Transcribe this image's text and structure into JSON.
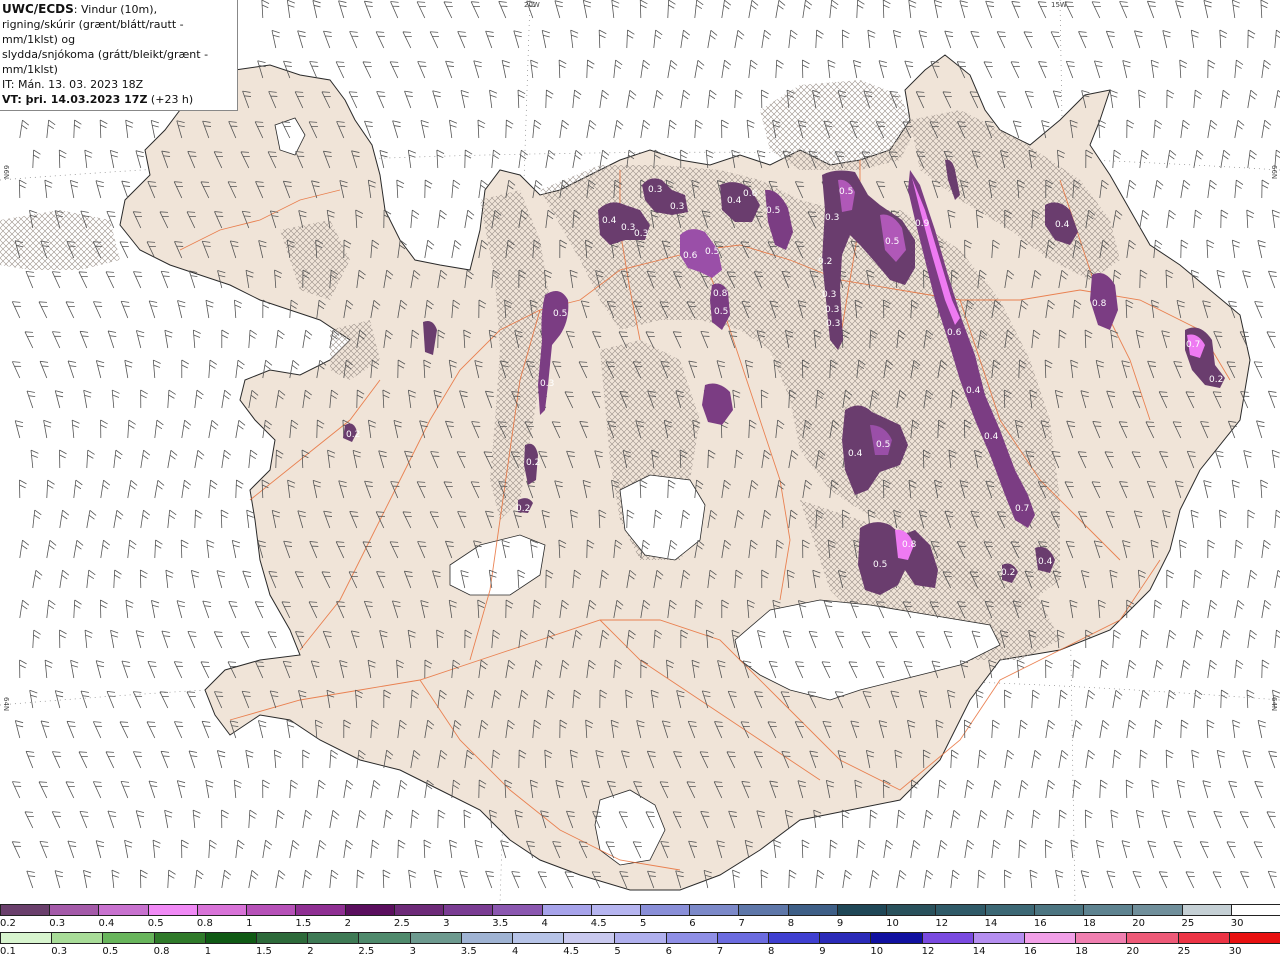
{
  "info": {
    "title": "UWC/ECDS",
    "line1_rest": ": Vindur (10m),",
    "line2": "rigning/skúrir (grænt/blátt/rautt - mm/1klst) og",
    "line3": "slydda/snjókoma (grátt/bleikt/grænt - mm/1klst)",
    "line4": "IT: Mán. 13. 03. 2023 18Z",
    "vt_bold": "VT: þri. 14.03.2023 17Z",
    "vt_rest": " (+23 h)"
  },
  "coord_labels": {
    "top_left": "20W",
    "top_right": "15W",
    "left_upper": "66N",
    "right_upper": "66N",
    "left_lower": "64N",
    "right_lower": "64N"
  },
  "colors": {
    "sea": "#ffffff",
    "land": "#f0e4d8",
    "roads": "#e8703a",
    "snow_dark": "#5a2a5c",
    "snow_mid": "#9a4fa8",
    "snow_light": "#ee7af2",
    "glacier": "#ffffff"
  },
  "precip_labels": [
    {
      "id": "a1",
      "text": "0.3"
    },
    {
      "id": "a2",
      "text": "0.3"
    },
    {
      "id": "a3",
      "text": "0.4"
    },
    {
      "id": "a4",
      "text": "0.3"
    },
    {
      "id": "a5",
      "text": "0.3"
    },
    {
      "id": "a6",
      "text": "0.4"
    },
    {
      "id": "a7",
      "text": "0.6"
    },
    {
      "id": "a8",
      "text": "0.5"
    },
    {
      "id": "a9",
      "text": "0.6"
    },
    {
      "id": "a10",
      "text": "0.5"
    },
    {
      "id": "a11",
      "text": "0.8"
    },
    {
      "id": "a12",
      "text": "0.5"
    },
    {
      "id": "a13",
      "text": "0.3"
    },
    {
      "id": "a14",
      "text": "0.2"
    },
    {
      "id": "a15",
      "text": "0.3"
    },
    {
      "id": "a16",
      "text": "0.3"
    },
    {
      "id": "a17",
      "text": "0.3"
    },
    {
      "id": "a18",
      "text": "0.5"
    },
    {
      "id": "a19",
      "text": "0.9"
    },
    {
      "id": "a20",
      "text": "0.6"
    },
    {
      "id": "a21",
      "text": "0.4"
    },
    {
      "id": "a22",
      "text": "0.4"
    },
    {
      "id": "a23",
      "text": "0.8"
    },
    {
      "id": "a24",
      "text": "0.7"
    },
    {
      "id": "a25",
      "text": "0.5"
    },
    {
      "id": "a26",
      "text": "0.4"
    },
    {
      "id": "a27",
      "text": "0.5"
    },
    {
      "id": "a28",
      "text": "0.4"
    },
    {
      "id": "a29",
      "text": "0.7"
    },
    {
      "id": "a30",
      "text": "0.8"
    },
    {
      "id": "a31",
      "text": "0.5"
    },
    {
      "id": "a32",
      "text": "0.2"
    },
    {
      "id": "a33",
      "text": "0.4"
    },
    {
      "id": "a34",
      "text": "0.5"
    },
    {
      "id": "a35",
      "text": "0.3"
    },
    {
      "id": "a36",
      "text": "0.2"
    },
    {
      "id": "a37",
      "text": "0.2"
    },
    {
      "id": "a38",
      "text": "0.2"
    },
    {
      "id": "a39",
      "text": "0.2"
    }
  ],
  "legend_snow": {
    "labels": [
      "0.2",
      "0.3",
      "0.4",
      "0.5",
      "0.8",
      "1",
      "1.5",
      "2",
      "2.5",
      "3",
      "3.5",
      "4",
      "4.5",
      "5",
      "6",
      "7",
      "8",
      "9",
      "10",
      "12",
      "14",
      "16",
      "18",
      "20",
      "25",
      "30"
    ],
    "colors": [
      "#6a3f6c",
      "#a45aa9",
      "#c872cf",
      "#f08af5",
      "#d873d8",
      "#b651b8",
      "#8f2f93",
      "#5a0f5e",
      "#6d2a78",
      "#7a3c93",
      "#8b57b0",
      "#a7a3ea",
      "#b6b5f0",
      "#8a8fd8",
      "#7c89c9",
      "#5e77a9",
      "#3e5f87",
      "#1f4757",
      "#29515c",
      "#2f5a68",
      "#3c6875",
      "#4c7581",
      "#5e8390",
      "#708f9b",
      "#c5d0d5",
      "#ffffff"
    ]
  },
  "legend_rain": {
    "labels": [
      "0.1",
      "0.3",
      "0.5",
      "0.8",
      "1",
      "1.5",
      "2",
      "2.5",
      "3",
      "3.5",
      "4",
      "4.5",
      "5",
      "6",
      "7",
      "8",
      "9",
      "10",
      "12",
      "14",
      "16",
      "18",
      "20",
      "25",
      "30"
    ],
    "colors": [
      "#d8f5cf",
      "#a8dc98",
      "#68b55c",
      "#2f7a2a",
      "#0f5a14",
      "#2d6a3a",
      "#3e7a55",
      "#4f8a6c",
      "#6d9a8f",
      "#9fb3d3",
      "#b7c4e8",
      "#c9c9ef",
      "#b0b0ee",
      "#8f8fe6",
      "#6b6bdf",
      "#3f3fd0",
      "#2a2ab8",
      "#1010a0",
      "#7a4ae0",
      "#b58ef0",
      "#f2a0e8",
      "#f07fb0",
      "#ee5a78",
      "#ec3445",
      "#e81010"
    ]
  }
}
